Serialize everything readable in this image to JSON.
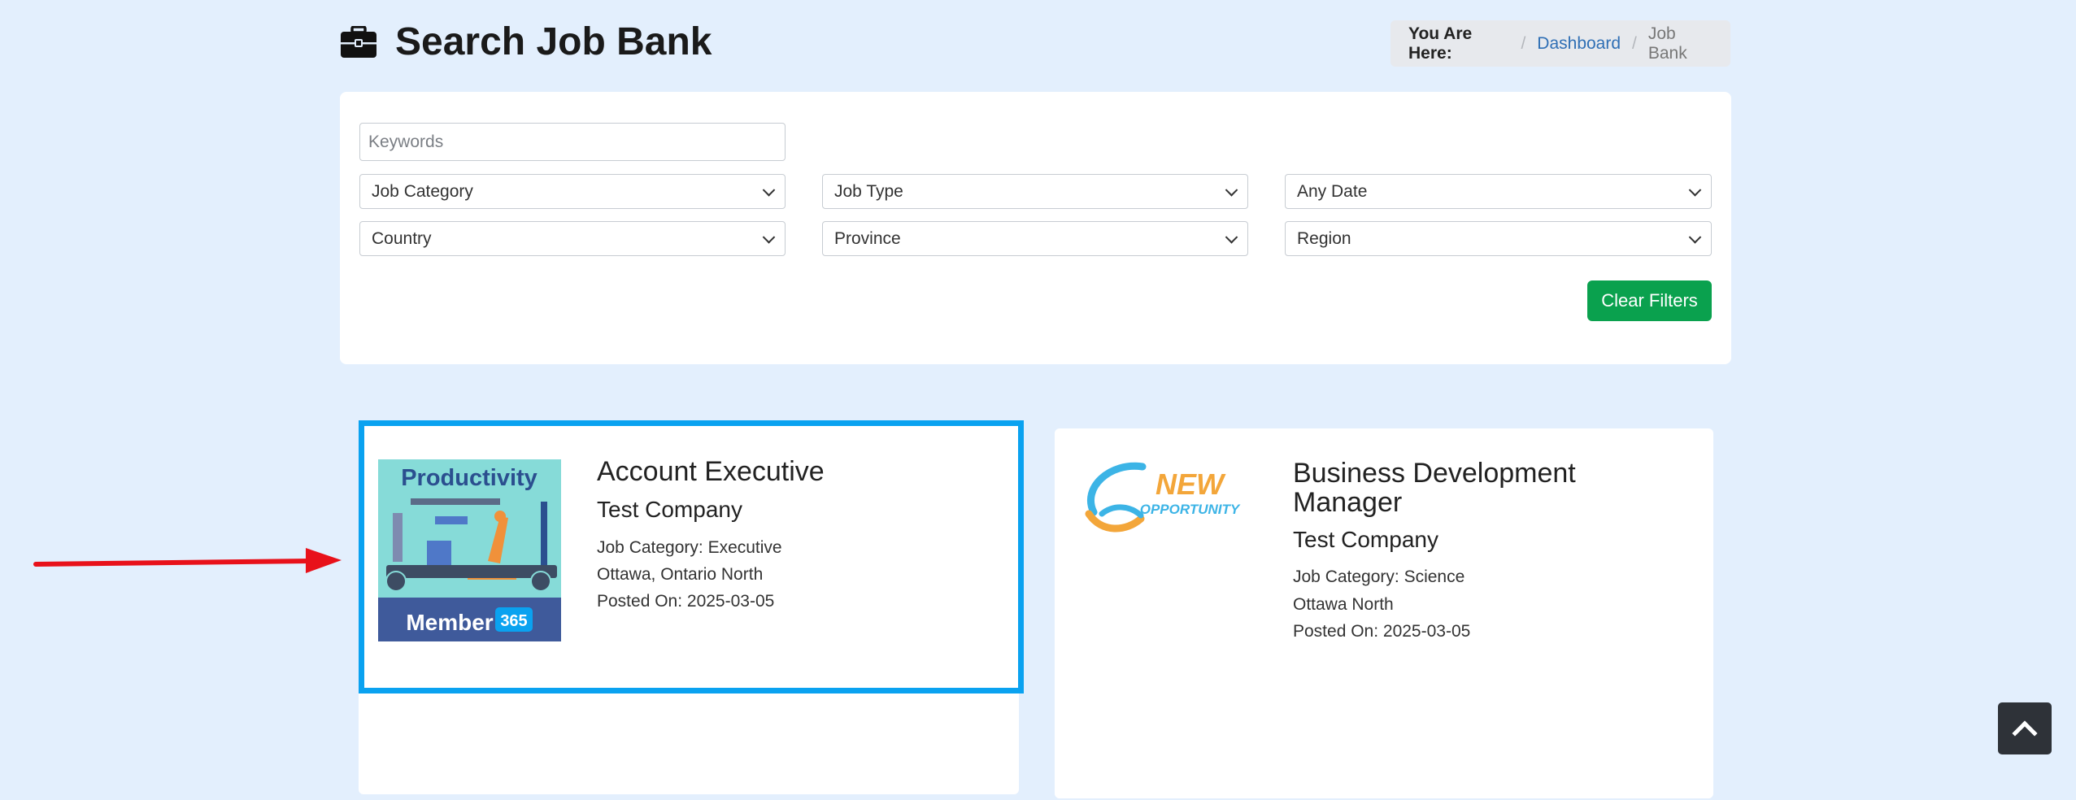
{
  "header": {
    "title": "Search Job Bank",
    "icon": "briefcase-icon"
  },
  "breadcrumb": {
    "label": "You Are Here:",
    "separator": "/",
    "items": [
      {
        "label": "Dashboard",
        "link": true
      },
      {
        "label": "Job Bank",
        "link": false
      }
    ]
  },
  "filters": {
    "keywords_placeholder": "Keywords",
    "job_category": "Job Category",
    "job_type": "Job Type",
    "date": "Any Date",
    "country": "Country",
    "province": "Province",
    "region": "Region",
    "clear_label": "Clear Filters"
  },
  "jobs": [
    {
      "title": "Account Executive",
      "company": "Test Company",
      "category": "Job Category: Executive",
      "location": "Ottawa, Ontario North",
      "posted": "Posted On: 2025-03-05",
      "image_heading": "Productivity",
      "image_brand": "Member",
      "image_badge": "365"
    },
    {
      "title": "Business Development Manager",
      "company": "Test Company",
      "category": "Job Category: Science",
      "location": "Ottawa North",
      "posted": "Posted On: 2025-03-05",
      "image_word1": "NEW",
      "image_word2": "OPPORTUNITY"
    }
  ],
  "colors": {
    "background": "#e3effd",
    "accent_green": "#0aa14e",
    "highlight_blue": "#0aa2f0",
    "link_blue": "#2f6fb5",
    "annotation_red": "#e8111a"
  }
}
